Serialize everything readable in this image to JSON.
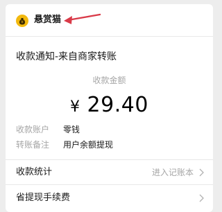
{
  "header": {
    "app_name": "悬赏猫",
    "app_icon": "money-bag-icon",
    "annotation": "red-arrow-pointing-left",
    "icon_color": "#f2b90f",
    "arrow_color": "#d93a48"
  },
  "notice": {
    "title": "收款通知-来自商家转账"
  },
  "payment": {
    "amount_label": "收款金额",
    "currency_symbol": "¥",
    "amount": "29.40"
  },
  "details": [
    {
      "key": "收款账户",
      "value": "零钱"
    },
    {
      "key": "转账备注",
      "value": "用户余额提现"
    }
  ],
  "links": [
    {
      "label": "收款统计",
      "value": "进入记账本",
      "icon": "chevron-right-icon"
    },
    {
      "label": "省提现手续费",
      "value": "",
      "icon": "chevron-right-icon"
    }
  ]
}
